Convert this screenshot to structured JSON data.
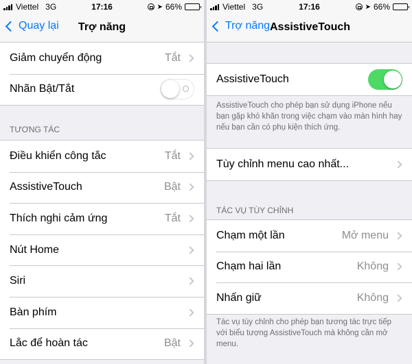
{
  "status_bar": {
    "carrier": "Viettel",
    "network": "3G",
    "time": "17:16",
    "battery": "66%",
    "battery_level": 0.66
  },
  "left": {
    "nav": {
      "back_label": "Quay lại",
      "title": "Trợ năng"
    },
    "top_rows": [
      {
        "label": "Giảm chuyển động",
        "value": "Tắt"
      },
      {
        "label": "Nhãn Bật/Tắt",
        "toggle": "off"
      }
    ],
    "section_header": "TƯƠNG TÁC",
    "rows": [
      {
        "label": "Điều khiển công tắc",
        "value": "Tắt"
      },
      {
        "label": "AssistiveTouch",
        "value": "Bật"
      },
      {
        "label": "Thích nghi cảm ứng",
        "value": "Tắt"
      },
      {
        "label": "Nút Home",
        "value": ""
      },
      {
        "label": "Siri",
        "value": ""
      },
      {
        "label": "Bàn phím",
        "value": ""
      },
      {
        "label": "Lắc để hoàn tác",
        "value": "Bật"
      }
    ]
  },
  "right": {
    "nav": {
      "back_label": "Trợ năng",
      "title": "AssistiveTouch"
    },
    "main_toggle": {
      "label": "AssistiveTouch",
      "state": "on"
    },
    "main_footnote": "AssistiveTouch cho phép bạn sử dụng iPhone nếu bạn gặp khó khăn trong việc chạm vào màn hình hay nếu bạn cần có phụ kiện thích ứng.",
    "customize_row": {
      "label": "Tùy chỉnh menu cao nhất..."
    },
    "section_header": "TÁC VỤ TÙY CHỈNH",
    "actions": [
      {
        "label": "Chạm một lần",
        "value": "Mở menu"
      },
      {
        "label": "Chạm hai lần",
        "value": "Không"
      },
      {
        "label": "Nhấn giữ",
        "value": "Không"
      }
    ],
    "actions_footnote": "Tác vụ tùy chỉnh cho phép bạn tương tác trực tiếp với biểu tượng AssistiveTouch mà không cần mở menu."
  },
  "colors": {
    "accent": "#007aff",
    "toggle_on": "#4cd964",
    "background": "#efeff4",
    "secondary_text": "#8e8e93"
  }
}
